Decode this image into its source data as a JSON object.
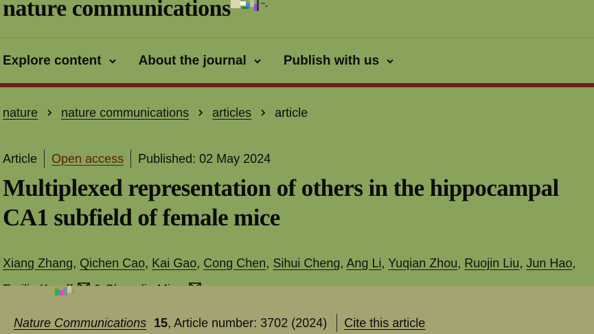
{
  "header": {
    "logo_text": "nature communications"
  },
  "nav": {
    "items": [
      {
        "label": "Explore content"
      },
      {
        "label": "About the journal"
      },
      {
        "label": "Publish with us"
      }
    ]
  },
  "breadcrumb": {
    "items": [
      "nature",
      "nature communications",
      "articles",
      "article"
    ]
  },
  "article": {
    "type": "Article",
    "access": "Open access",
    "published": "Published: 02 May 2024",
    "title": "Multiplexed representation of others in the hippocampal CA1 subfield of female mice",
    "authors_line1": [
      "Xiang Zhang",
      "Qichen Cao",
      "Kai Gao",
      "Cong Chen",
      "Sihui Cheng",
      "Ang Li",
      "Yuqian Zhou",
      "Ruojin Liu",
      "Jun Hao"
    ],
    "authors_line2": [
      "Emilio Kropff",
      "Chenglin Miao"
    ],
    "author_joiner": "&"
  },
  "citation": {
    "journal": "Nature Communications",
    "volume": "15",
    "article_number": ", Article number: 3702 (2024)",
    "cite_label": "Cite this article"
  },
  "colors": {
    "background": "#8aa35c",
    "nav_rule": "#6e1c1c",
    "lower_band": "#a4a473",
    "open_access_text": "#5a1e08"
  },
  "icons": [
    "chevron-down-icon",
    "chevron-right-icon",
    "mail-icon"
  ]
}
